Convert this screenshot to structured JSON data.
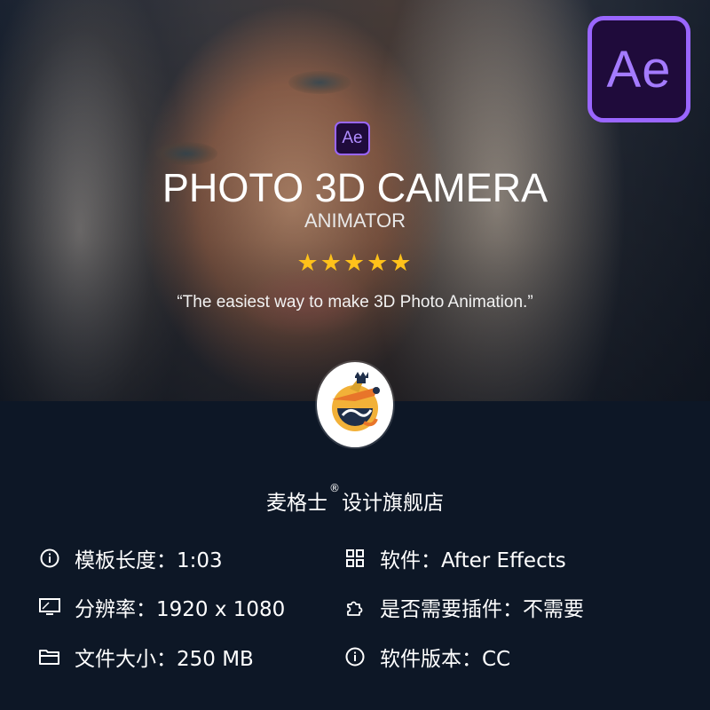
{
  "hero": {
    "badge_large": "Ae",
    "badge_small": "Ae",
    "title": "PHOTO 3D CAMERA",
    "subtitle": "ANIMATOR",
    "stars": "★★★★★",
    "rating": 5,
    "quote": "“The easiest way to make 3D Photo Animation.”"
  },
  "store": {
    "name_prefix": "麦格士",
    "registered": "®",
    "name_suffix": "设计旗舰店"
  },
  "specs": {
    "template_length": "模板长度：1:03",
    "software": "软件：After Effects",
    "resolution": "分辨率：1920 x 1080",
    "plugin_required": "是否需要插件：不需要",
    "file_size": "文件大小：250 MB",
    "software_version": "软件版本：CC"
  },
  "icons": {
    "template_length": "info-circle-icon",
    "software": "grid-icon",
    "resolution": "monitor-icon",
    "plugin_required": "puzzle-icon",
    "file_size": "folder-icon",
    "software_version": "info-circle-icon"
  },
  "colors": {
    "background": "#0d1726",
    "ae_purple": "#9a66ff",
    "ae_dark": "#1f0b3b",
    "star": "#ffc21a"
  }
}
